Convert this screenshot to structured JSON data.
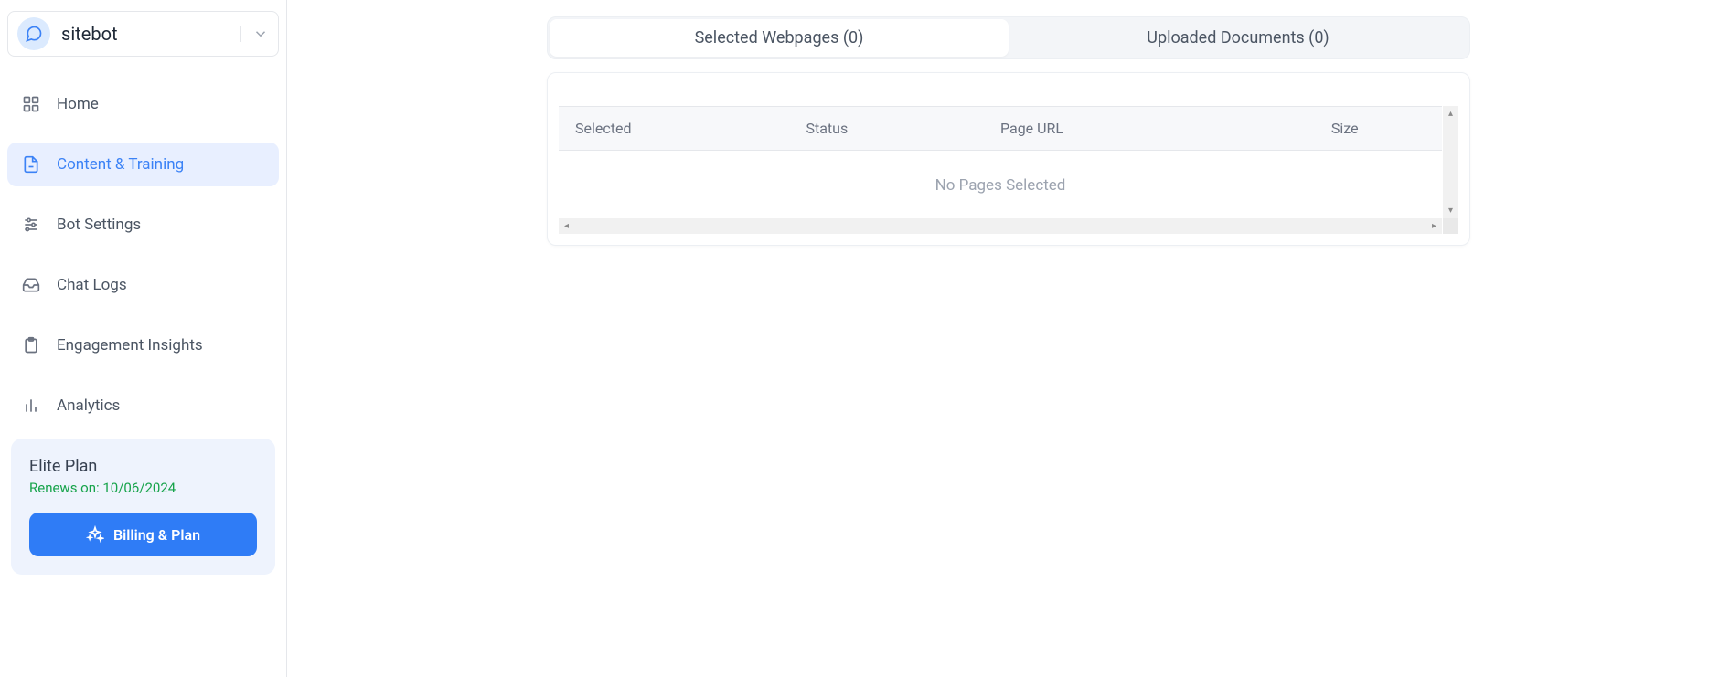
{
  "bot_selector": {
    "name": "sitebot"
  },
  "sidebar": {
    "items": [
      {
        "label": "Home"
      },
      {
        "label": "Content & Training"
      },
      {
        "label": "Bot Settings"
      },
      {
        "label": "Chat Logs"
      },
      {
        "label": "Engagement Insights"
      },
      {
        "label": "Analytics"
      }
    ]
  },
  "plan": {
    "title": "Elite Plan",
    "renews": "Renews on: 10/06/2024",
    "button_label": "Billing & Plan"
  },
  "tabs": {
    "selected_label": "Selected Webpages (0)",
    "uploaded_label": "Uploaded Documents (0)"
  },
  "table": {
    "headers": {
      "selected": "Selected",
      "status": "Status",
      "url": "Page URL",
      "size": "Size"
    },
    "empty_message": "No Pages Selected"
  }
}
